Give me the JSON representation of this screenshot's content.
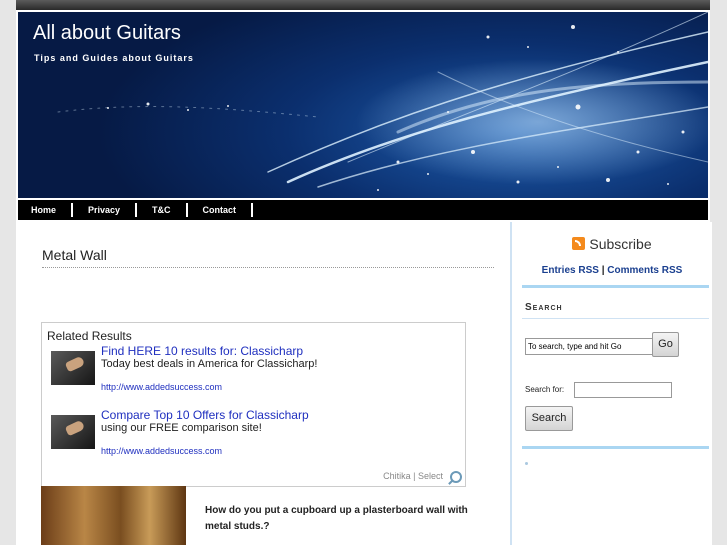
{
  "header": {
    "title": "All about Guitars",
    "tagline": "Tips and Guides about Guitars"
  },
  "nav": {
    "items": [
      "Home",
      "Privacy",
      "T&C",
      "Contact"
    ]
  },
  "post": {
    "title": "Metal Wall"
  },
  "related": {
    "heading": "Related Results",
    "items": [
      {
        "link": "Find HERE 10 results for: Classicharp",
        "desc": "Today best deals in America for Classicharp!",
        "url": "http://www.addedsuccess.com"
      },
      {
        "link": "Compare Top 10 Offers for Classicharp",
        "desc": "using our FREE comparison site!",
        "url": "http://www.addedsuccess.com"
      }
    ],
    "footer": "Chitika | Select"
  },
  "article": {
    "question": "How do you put a cupboard up a plasterboard wall with metal studs.?"
  },
  "sidebar": {
    "subscribe": "Subscribe",
    "entries_rss": "Entries RSS",
    "separator": "|",
    "comments_rss": "Comments RSS",
    "search_title": "Search",
    "search_input_value": "To search, type and hit Go",
    "go_label": "Go",
    "search_for_label": "Search for:",
    "search_button": "Search"
  }
}
